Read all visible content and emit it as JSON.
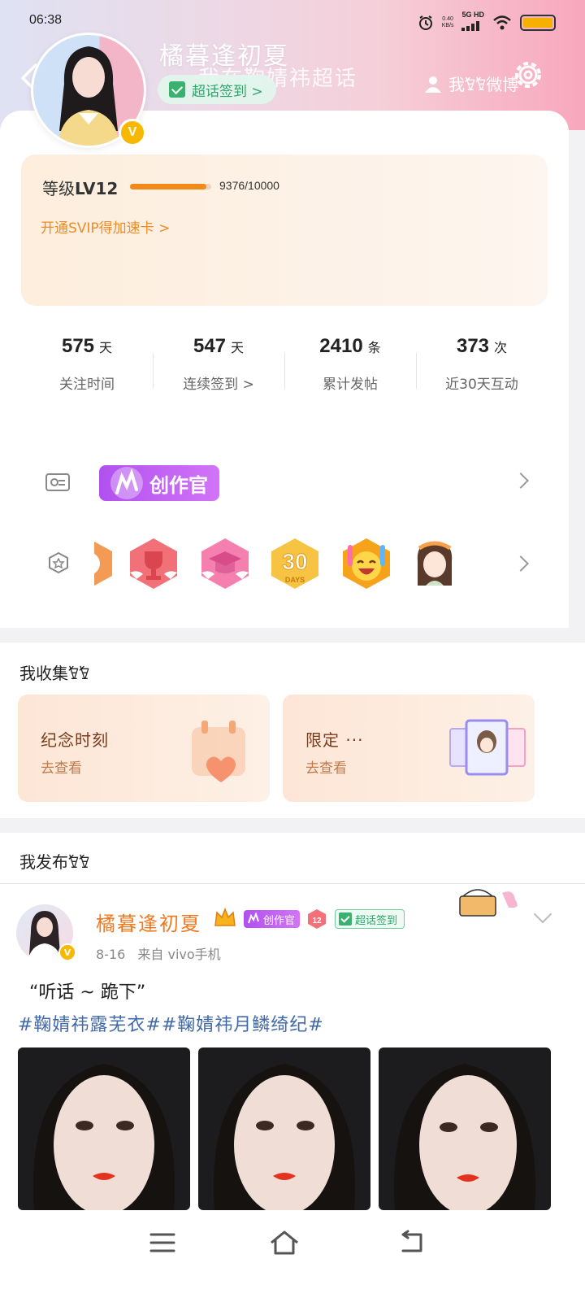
{
  "status_bar": {
    "time": "06:38",
    "net_speed_value": "0.40",
    "net_speed_unit": "KB/s",
    "network": "5G HD",
    "battery_level": 1.0
  },
  "header": {
    "username": "橘暮逢初夏",
    "banner_text": "我在鞠婧祎超话",
    "signin_label": "超话签到 >",
    "my_weibo_label": "我𐘸𐘸微博",
    "colors": {
      "signin_green": "#3bb16f",
      "avatar_badge": "#f8b800"
    }
  },
  "level": {
    "label_prefix": "等级",
    "level": "LV12",
    "progress_text": "9376/10000",
    "progress_fraction": 0.9376,
    "svip_link": "开通SVIP得加速卡 >"
  },
  "stats": [
    {
      "value": "575",
      "unit": "天",
      "label": "关注时间"
    },
    {
      "value": "547",
      "unit": "天",
      "label": "连续签到 >"
    },
    {
      "value": "2410",
      "unit": "条",
      "label": "累计发帖"
    },
    {
      "value": "373",
      "unit": "次",
      "label": "近30天互动"
    }
  ],
  "badges": {
    "creator_label": "创作官",
    "medal_days_text": "30",
    "medal_days_sub": "DAYS",
    "medals": [
      "partial-medal",
      "trophy-medal",
      "graduation-cap-medal",
      "30-days-medal",
      "laughing-face-medal",
      "character-medal"
    ]
  },
  "collections": {
    "title": "我收集𐘸𐘸",
    "cards": [
      {
        "title": "纪念时刻",
        "subtitle": "去查看"
      },
      {
        "title": "限定 ···",
        "subtitle": "去查看"
      }
    ]
  },
  "posts": {
    "title": "我发布𐘸𐘸",
    "item": {
      "author": "橘暮逢初夏",
      "creator_tag": "创作官",
      "level_badge": "12",
      "signin_tag": "超话签到",
      "date": "8-16",
      "source": "来自  vivo手机",
      "text": "“听话 ~ 跪下”",
      "topics": "#鞠婧祎露芜衣##鞠婧祎月鳞绮纪#"
    }
  }
}
